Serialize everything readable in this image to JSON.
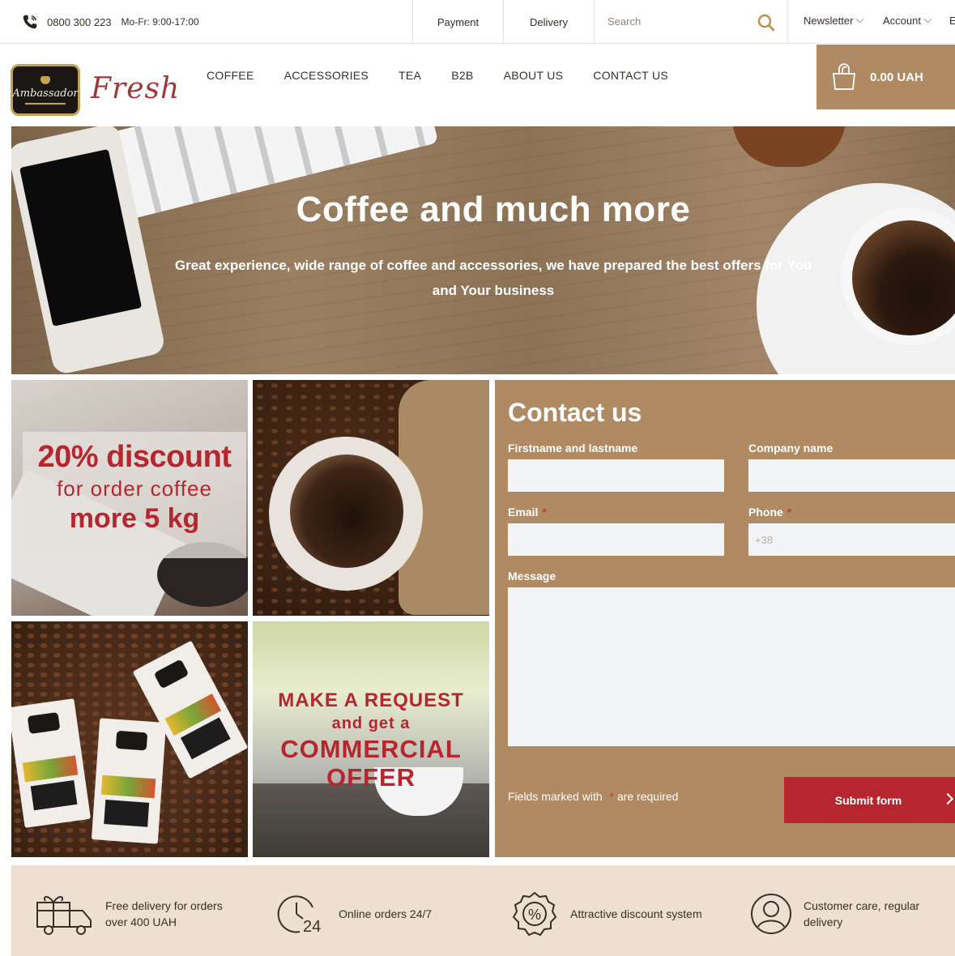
{
  "topbar": {
    "phone": "0800 300 223",
    "hours": "Mo-Fr: 9:00-17:00",
    "links": [
      "Payment",
      "Delivery"
    ],
    "search_placeholder": "Search",
    "newsletter": "Newsletter",
    "account": "Account",
    "language": "E"
  },
  "header": {
    "logo_text": "Ambassador",
    "brand_script": "Fresh",
    "nav": [
      "COFFEE",
      "ACCESSORIES",
      "TEA",
      "B2B",
      "ABOUT US",
      "CONTACT US"
    ],
    "cart_amount": "0.00 UAH"
  },
  "hero": {
    "title": "Coffee and much more",
    "subtitle": "Great experience, wide range of coffee and accessories, we have prepared the best offers for You and Your business"
  },
  "promo_discount": {
    "line1": "20% discount",
    "line2": "for order coffee",
    "line3": "more 5 kg"
  },
  "promo_request": {
    "line1": "MAKE A REQUEST",
    "line2": "and get a",
    "line3": "COMMERCIAL",
    "line4": "OFFER"
  },
  "contact": {
    "title": "Contact us",
    "name_label": "Firstname and lastname",
    "company_label": "Company name",
    "email_label": "Email",
    "phone_label": "Phone",
    "phone_placeholder": "+38",
    "message_label": "Message",
    "required_mark": "*",
    "note_before": "Fields marked with",
    "note_after": "are required",
    "submit_label": "Submit form"
  },
  "features": [
    {
      "icon": "delivery-truck-icon",
      "text_line1": "Free delivery for orders",
      "text_line2": "over 400 UAH"
    },
    {
      "icon": "clock-24-icon",
      "text_line1": "Online orders 24/7",
      "text_line2": ""
    },
    {
      "icon": "discount-badge-icon",
      "text_line1": "Attractive discount system",
      "text_line2": ""
    },
    {
      "icon": "customer-care-icon",
      "text_line1": "Customer care, regular",
      "text_line2": "delivery"
    }
  ],
  "colors": {
    "accent_brown": "#af8a62",
    "accent_red": "#b5262e",
    "features_bg": "#eddfd2"
  }
}
